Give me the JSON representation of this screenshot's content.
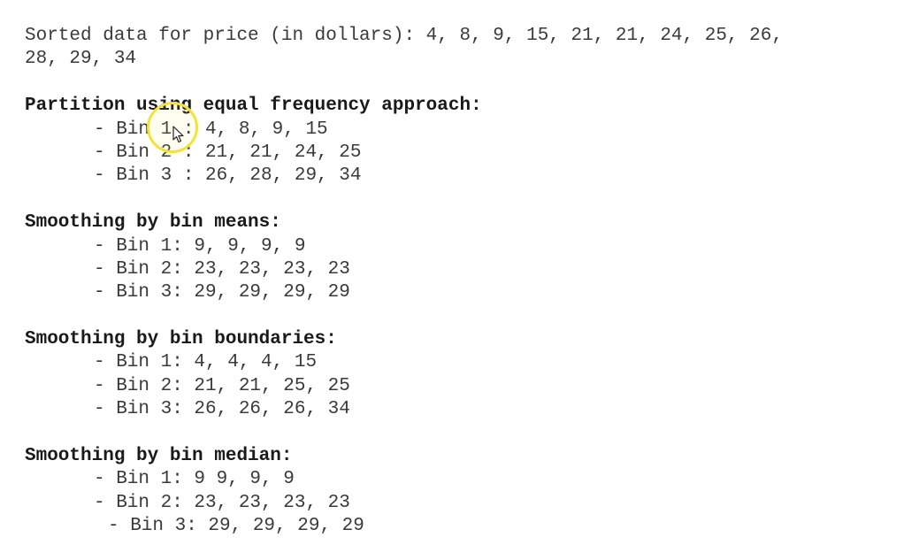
{
  "sorted_data": {
    "line1": "Sorted data for price (in dollars): 4, 8, 9, 15, 21, 21, 24, 25, 26,",
    "line2": "28, 29, 34"
  },
  "partition": {
    "heading": "Partition using equal frequency approach:",
    "items": [
      "- Bin 1 : 4, 8, 9, 15",
      "- Bin 2 : 21, 21, 24, 25",
      "- Bin 3 : 26, 28, 29, 34"
    ]
  },
  "means": {
    "heading": "Smoothing by bin means:",
    "items": [
      "- Bin 1: 9, 9, 9, 9",
      "- Bin 2: 23, 23, 23, 23",
      "- Bin 3: 29, 29, 29, 29"
    ]
  },
  "boundaries": {
    "heading": "Smoothing by bin boundaries:",
    "items": [
      "- Bin 1: 4, 4, 4, 15",
      "- Bin 2: 21, 21, 25, 25",
      "- Bin 3: 26, 26, 26, 34"
    ]
  },
  "median": {
    "heading": "Smoothing by bin median:",
    "items": [
      "- Bin 1: 9 9, 9, 9",
      "- Bin 2: 23, 23, 23, 23",
      "- Bin 3: 29, 29, 29, 29"
    ]
  },
  "icons": {
    "cursor": "mouse-pointer-icon",
    "highlight": "cursor-highlight-circle"
  },
  "colors": {
    "text": "#3a3a3a",
    "heading": "#1a1a1a",
    "highlight": "#f2e23a"
  }
}
